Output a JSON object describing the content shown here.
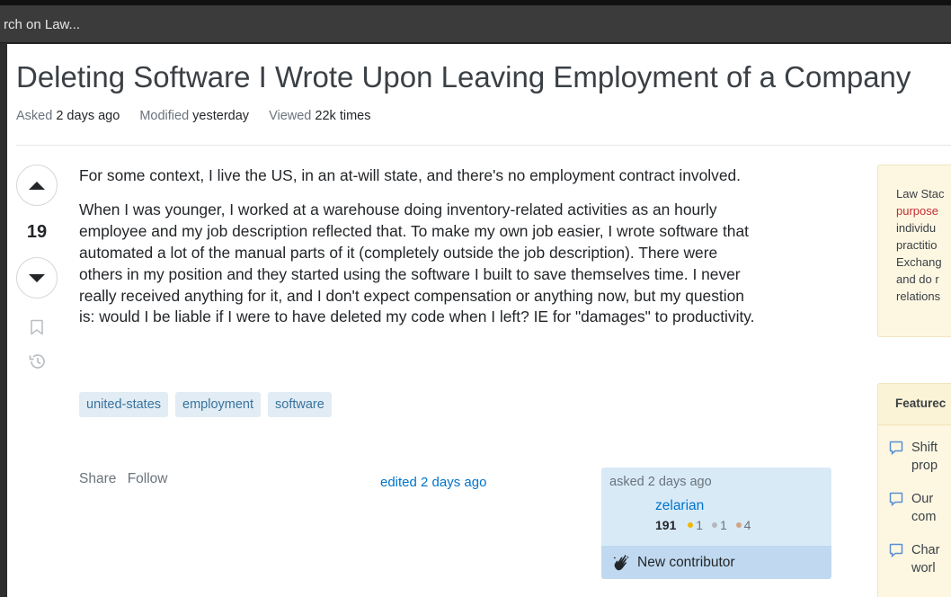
{
  "search": {
    "text": "rch on Law..."
  },
  "question": {
    "title": "Deleting Software I Wrote Upon Leaving Employment of a Company",
    "meta": {
      "asked_label": "Asked",
      "asked_value": "2 days ago",
      "modified_label": "Modified",
      "modified_value": "yesterday",
      "viewed_label": "Viewed",
      "viewed_value": "22k times"
    },
    "votes": "19",
    "body": [
      "For some context, I live the US, in an at-will state, and there's no employment contract involved.",
      "When I was younger, I worked at a warehouse doing inventory-related activities as an hourly",
      "employee and my job description reflected that. To make my own job easier, I wrote software that",
      "automated a lot of the manual parts of it (completely outside the job description). There were",
      "others in my position and they started using the software I built to save themselves time. I never",
      "really received anything for it, and I don't expect compensation or anything now, but my question",
      "is: would I be liable if I were to have deleted my code when I left? IE for \"damages\" to productivity."
    ],
    "tags": [
      "united-states",
      "employment",
      "software"
    ],
    "actions": {
      "share": "Share",
      "follow": "Follow"
    },
    "edited": "edited 2 days ago",
    "owner": {
      "asked": "asked 2 days ago",
      "name": "zelarian",
      "rep": "191",
      "gold": "1",
      "silver": "1",
      "bronze": "4",
      "new_contributor": "New contributor"
    }
  },
  "sidebar": {
    "notice_lines": [
      "Law Stac",
      "purpose",
      "individu",
      "practitio",
      "Exchang",
      "and do r",
      "relations"
    ],
    "featured_title": "Featurec",
    "featured_items": [
      [
        "Shift",
        "prop"
      ],
      [
        "Our",
        "com"
      ],
      [
        "Char",
        "worl"
      ]
    ]
  },
  "colors": {
    "accent_link": "#0074cc",
    "tag_bg": "#e1ecf4",
    "tag_text": "#39739d",
    "owner_bg": "#d9eaf7",
    "gold": "#f1b600",
    "silver": "#b4b8bc",
    "bronze": "#d1a684"
  }
}
